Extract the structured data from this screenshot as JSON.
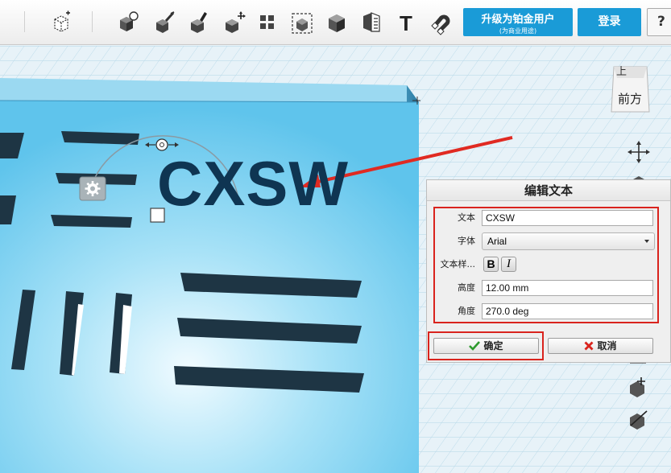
{
  "toolbar": {
    "upgrade_label": "升级为铂金用户",
    "upgrade_sub": "(为商业用途)",
    "login_label": "登录",
    "help_label": "?",
    "text_tool_glyph": "T",
    "tools": [
      "transform-icon",
      "snap-icon",
      "paint-icon",
      "pencil-icon",
      "move-icon",
      "pattern-icon",
      "scale-icon",
      "solid-icon",
      "measure-icon",
      "text-icon",
      "magnet-icon"
    ]
  },
  "scene": {
    "object_text": "CXSW",
    "view_cube": {
      "top": "上",
      "front": "前方"
    }
  },
  "dialog": {
    "title": "编辑文本",
    "fields": {
      "text_label": "文本",
      "text_value": "CXSW",
      "font_label": "字体",
      "font_value": "Arial",
      "style_label": "文本样...",
      "bold_label": "B",
      "italic_label": "I",
      "height_label": "高度",
      "height_value": "12.00 mm",
      "angle_label": "角度",
      "angle_value": "270.0 deg"
    },
    "ok_label": "确定",
    "cancel_label": "取消"
  },
  "colors": {
    "accent": "#1a9bd7",
    "highlight": "#d9231d",
    "plate": "#7ed3f2",
    "slot": "#1e3544"
  }
}
